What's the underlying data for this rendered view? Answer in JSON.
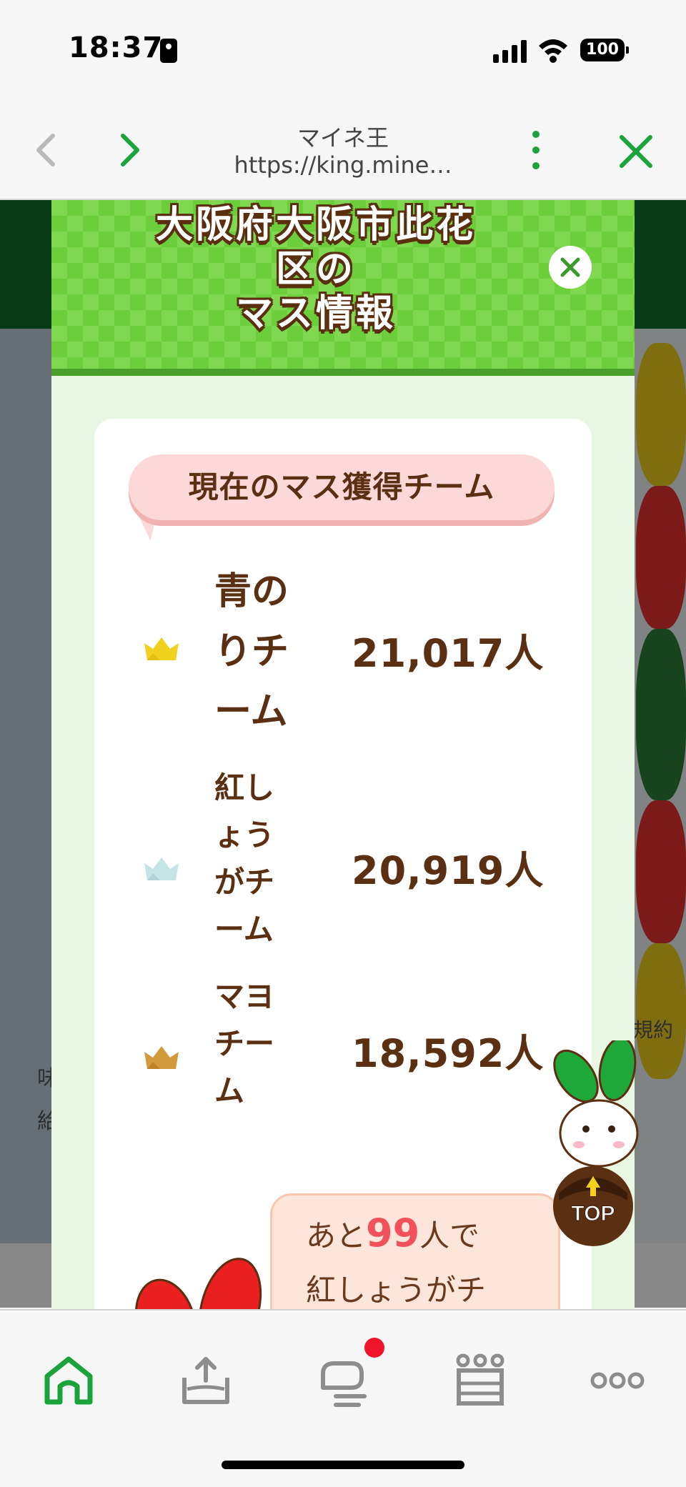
{
  "status_bar": {
    "time": "18:37",
    "battery": "100"
  },
  "browser": {
    "title": "マイネ王",
    "url": "https://king.mine…"
  },
  "background": {
    "left_text": "味 給",
    "right_text": "規約"
  },
  "modal": {
    "title": "大阪府大阪市此花区の\nマス情報",
    "title_lines": [
      "大阪府大阪市此花",
      "区の",
      "マス情報"
    ],
    "section_label": "現在のマス獲得チーム",
    "teams": [
      {
        "name": "青のりチーム",
        "count": "21,017人",
        "crown_color": "#f0d21e"
      },
      {
        "name": "紅しょうがチーム",
        "count": "20,919人",
        "crown_color": "#c6e4e6"
      },
      {
        "name": "マヨチーム",
        "count": "18,592人",
        "crown_color": "#d39a3c"
      }
    ],
    "hint": {
      "prefix": "あと",
      "number": "99",
      "suffix": "人で",
      "line2": "紅しょうがチ"
    }
  },
  "top_button": {
    "label": "TOP"
  },
  "bottom_nav": {
    "items": [
      "home-icon",
      "upload-icon",
      "chat-icon",
      "ranking-icon",
      "more-icon"
    ],
    "accent": "#1aa33a"
  },
  "colors": {
    "brand_green": "#0d6a28",
    "accent_green": "#1aa33a",
    "text_brown": "#5b2f12",
    "highlight_red": "#f2505a"
  }
}
